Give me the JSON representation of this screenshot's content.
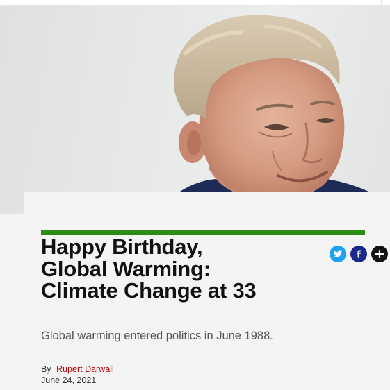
{
  "article": {
    "headline": "Happy Birthday, Global Warming: Climate Change at 33",
    "subheadline": "Global warming entered politics in June 1988.",
    "byline_prefix": "By",
    "author": "Rupert Darwall",
    "date": "June 24, 2021"
  },
  "share_buttons": [
    {
      "icon": "twitter-icon",
      "color": "#1da1f2"
    },
    {
      "icon": "facebook-icon",
      "color": "#1b2a8a"
    },
    {
      "icon": "plus-icon",
      "color": "#111111"
    }
  ],
  "hero_image": {
    "description_icon": "portrait-photo"
  },
  "colors": {
    "accent_rule": "#2e8b12",
    "author_link": "#b30000",
    "background": "#f4f4f4"
  }
}
